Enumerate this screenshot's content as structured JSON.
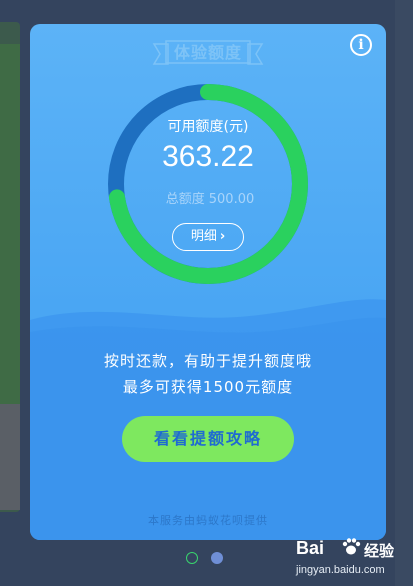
{
  "modal": {
    "badge": "体验额度",
    "info_icon": "info-icon",
    "ring": {
      "label": "可用额度(元)",
      "value": "363.22",
      "total_label": "总额度",
      "total_value": "500.00",
      "used_fraction": 0.2736,
      "colors": {
        "track": "#1e6fc0",
        "progress": "#2ad15e"
      }
    },
    "detail_button": "明细",
    "message_line1": "按时还款，有助于提升额度哦",
    "message_line2": "最多可获得1500元额度",
    "cta_button": "看看提额攻略",
    "footer_note": "本服务由蚂蚁花呗提供"
  },
  "pager": {
    "count": 2,
    "active_index": 0
  },
  "watermark": {
    "logo": "Bai",
    "logo_suffix": "经验",
    "url": "jingyan.baidu.com"
  },
  "colors": {
    "card_top": "#5cb3f7",
    "card_bottom": "#3d99ef",
    "cta_bg": "#7ee85f",
    "cta_text": "#1f6bd1"
  }
}
